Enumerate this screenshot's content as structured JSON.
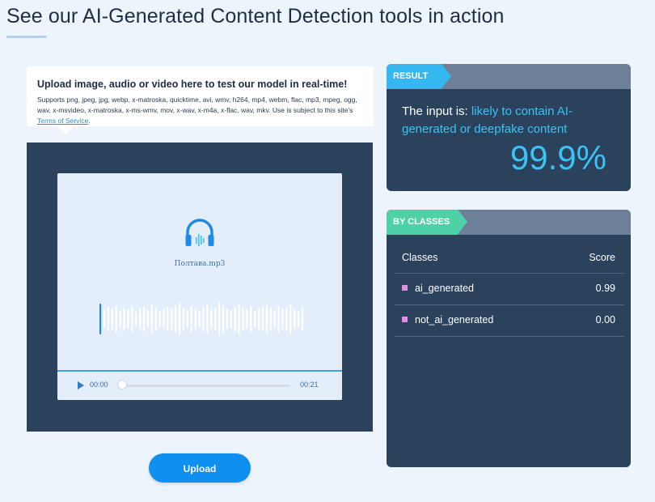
{
  "page": {
    "title": "See our AI-Generated Content Detection tools in action"
  },
  "upload_info": {
    "heading": "Upload image, audio or video here to test our model in real-time!",
    "supports_text": "Supports png, jpeg, jpg, webp, x-matroska, quicktime, avi, wmv, h264, mp4, webm, flac, mp3, mpeg, ogg, wav, x-msvideo, x-matroska, x-ms-wmv, mov, x-wav, x-m4a, x-flac, wav, mkv. Use is subject to this site's",
    "terms_link": "Terms of Service",
    "terms_suffix": "."
  },
  "media": {
    "icon": "headphones-icon",
    "file_name": "Полтава.mp3",
    "current_time": "00:00",
    "total_time": "00:21",
    "progress": 0
  },
  "upload_button": {
    "label": "Upload"
  },
  "result": {
    "tag": "RESULT",
    "prefix": "The input is: ",
    "verdict": "likely to contain AI-generated or deepfake content",
    "score": "99.9%"
  },
  "by_classes": {
    "tag": "BY CLASSES",
    "col_classes": "Classes",
    "col_score": "Score",
    "rows": [
      {
        "name": "ai_generated",
        "score": "0.99"
      },
      {
        "name": "not_ai_generated",
        "score": "0.00"
      }
    ]
  },
  "colors": {
    "accent": "#35b7f0",
    "classes_tag": "#4fd1a8",
    "panel_bg": "#2a425c",
    "class_swatch": "#e58ce6"
  }
}
